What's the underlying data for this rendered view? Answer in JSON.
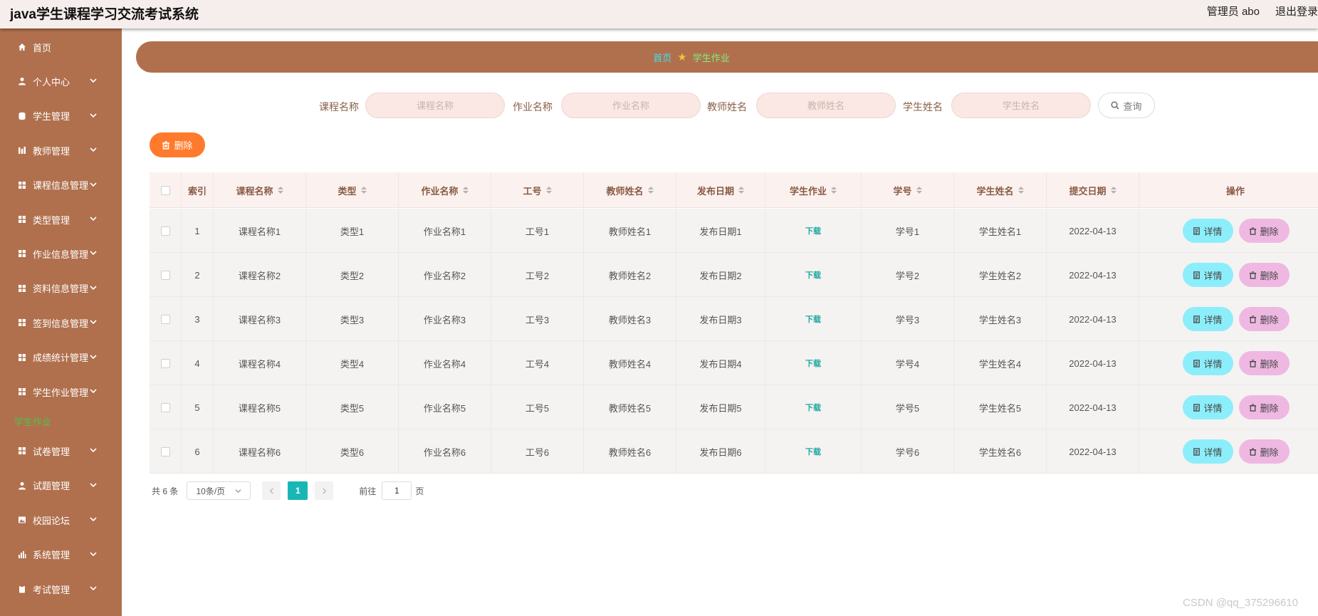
{
  "header": {
    "title": "java学生课程学习交流考试系统",
    "user": "管理员 abo",
    "logout": "退出登录"
  },
  "sidebar": {
    "items": [
      {
        "label": "首页",
        "icon": "home-icon",
        "expandable": false
      },
      {
        "label": "个人中心",
        "icon": "user-icon",
        "expandable": true
      },
      {
        "label": "学生管理",
        "icon": "database-icon",
        "expandable": true
      },
      {
        "label": "教师管理",
        "icon": "chart-icon",
        "expandable": true
      },
      {
        "label": "课程信息管理",
        "icon": "grid-icon",
        "expandable": true
      },
      {
        "label": "类型管理",
        "icon": "grid-icon",
        "expandable": true
      },
      {
        "label": "作业信息管理",
        "icon": "grid-icon",
        "expandable": true
      },
      {
        "label": "资料信息管理",
        "icon": "grid-icon",
        "expandable": true
      },
      {
        "label": "签到信息管理",
        "icon": "grid-icon",
        "expandable": true
      },
      {
        "label": "成绩统计管理",
        "icon": "grid-icon",
        "expandable": true
      },
      {
        "label": "学生作业管理",
        "icon": "grid-icon",
        "expandable": true
      },
      {
        "label": "试卷管理",
        "icon": "grid-icon",
        "expandable": true
      },
      {
        "label": "试题管理",
        "icon": "user-icon",
        "expandable": true
      },
      {
        "label": "校园论坛",
        "icon": "picture-icon",
        "expandable": true
      },
      {
        "label": "系统管理",
        "icon": "bar-chart-icon",
        "expandable": true
      },
      {
        "label": "考试管理",
        "icon": "clipboard-icon",
        "expandable": true
      }
    ],
    "active_sub": "学生作业"
  },
  "breadcrumb": {
    "home": "首页",
    "current": "学生作业"
  },
  "search": {
    "fields": [
      {
        "label": "课程名称",
        "placeholder": "课程名称"
      },
      {
        "label": "作业名称",
        "placeholder": "作业名称"
      },
      {
        "label": "教师姓名",
        "placeholder": "教师姓名"
      },
      {
        "label": "学生姓名",
        "placeholder": "学生姓名"
      }
    ],
    "query_label": "查询"
  },
  "actions": {
    "delete_label": "删除"
  },
  "table": {
    "columns": [
      "索引",
      "课程名称",
      "类型",
      "作业名称",
      "工号",
      "教师姓名",
      "发布日期",
      "学生作业",
      "学号",
      "学生姓名",
      "提交日期",
      "操作"
    ],
    "rows": [
      {
        "index": "1",
        "course": "课程名称1",
        "type": "类型1",
        "homework": "作业名称1",
        "job_no": "工号1",
        "teacher": "教师姓名1",
        "publish": "发布日期1",
        "file": "下载",
        "student_no": "学号1",
        "student": "学生姓名1",
        "submit": "2022-04-13"
      },
      {
        "index": "2",
        "course": "课程名称2",
        "type": "类型2",
        "homework": "作业名称2",
        "job_no": "工号2",
        "teacher": "教师姓名2",
        "publish": "发布日期2",
        "file": "下载",
        "student_no": "学号2",
        "student": "学生姓名2",
        "submit": "2022-04-13"
      },
      {
        "index": "3",
        "course": "课程名称3",
        "type": "类型3",
        "homework": "作业名称3",
        "job_no": "工号3",
        "teacher": "教师姓名3",
        "publish": "发布日期3",
        "file": "下载",
        "student_no": "学号3",
        "student": "学生姓名3",
        "submit": "2022-04-13"
      },
      {
        "index": "4",
        "course": "课程名称4",
        "type": "类型4",
        "homework": "作业名称4",
        "job_no": "工号4",
        "teacher": "教师姓名4",
        "publish": "发布日期4",
        "file": "下载",
        "student_no": "学号4",
        "student": "学生姓名4",
        "submit": "2022-04-13"
      },
      {
        "index": "5",
        "course": "课程名称5",
        "type": "类型5",
        "homework": "作业名称5",
        "job_no": "工号5",
        "teacher": "教师姓名5",
        "publish": "发布日期5",
        "file": "下载",
        "student_no": "学号5",
        "student": "学生姓名5",
        "submit": "2022-04-13"
      },
      {
        "index": "6",
        "course": "课程名称6",
        "type": "类型6",
        "homework": "作业名称6",
        "job_no": "工号6",
        "teacher": "教师姓名6",
        "publish": "发布日期6",
        "file": "下载",
        "student_no": "学号6",
        "student": "学生姓名6",
        "submit": "2022-04-13"
      }
    ],
    "detail_label": "详情",
    "delete_label": "删除"
  },
  "pagination": {
    "total": "共 6 条",
    "page_size": "10条/页",
    "current_page": "1",
    "goto_prefix": "前往",
    "goto_value": "1",
    "goto_suffix": "页"
  },
  "watermark": "CSDN @qq_375296610",
  "colors": {
    "sidebar": "#b0704d",
    "delete_button": "#ff7a2c",
    "detail_button": "#8ceefa",
    "row_delete_button": "#efb8e2",
    "pager_active": "#19b6b6"
  }
}
